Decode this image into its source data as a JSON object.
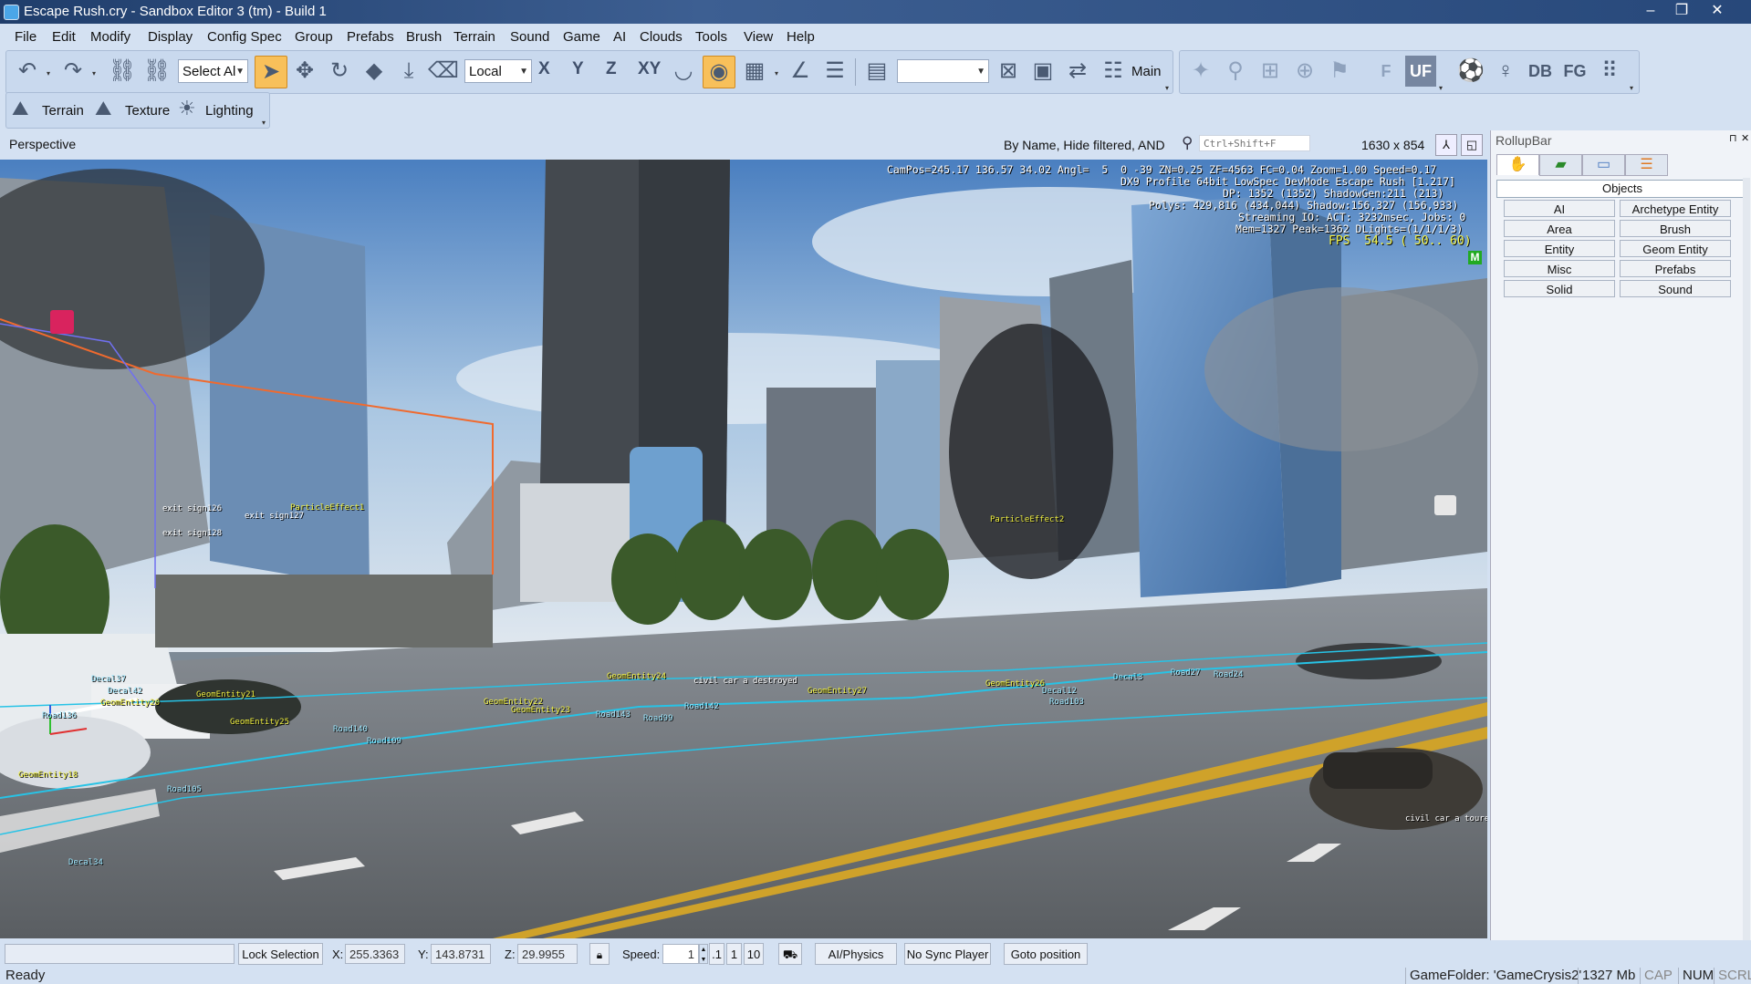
{
  "window": {
    "title": "Escape Rush.cry - Sandbox Editor 3 (tm) - Build 1",
    "min": "–",
    "max": "❐",
    "close": "✕"
  },
  "menu": [
    "File",
    "Edit",
    "Modify",
    "Display",
    "Config Spec",
    "Group",
    "Prefabs",
    "Brush",
    "Terrain",
    "Sound",
    "Game",
    "AI",
    "Clouds",
    "Tools",
    "View",
    "Help"
  ],
  "toolbar": {
    "select_mode": "Select Al",
    "coord_system": "Local",
    "axis_x": "X",
    "axis_y": "Y",
    "axis_z": "Z",
    "axis_xy": "XY",
    "layer_combo": "",
    "layer_label": "Main",
    "btn_f": "F",
    "btn_uf": "UF",
    "btn_db": "DB",
    "btn_fg": "FG"
  },
  "toolbar2": {
    "terrain": "Terrain",
    "texture": "Texture",
    "lighting": "Lighting"
  },
  "viewport": {
    "title": "Perspective",
    "filter": "By Name, Hide filtered, AND",
    "search_placeholder": "Ctrl+Shift+F",
    "resolution": "1630 x 854",
    "hud": [
      "CamPos=245.17 136.57 34.02 Angl=  5  0 -39 ZN=0.25 ZF=4563 FC=0.04 Zoom=1.00 Speed=0.17",
      "DX9 Profile 64bit LowSpec DevMode Escape Rush [1.217]",
      "DP: 1352 (1352) ShadowGen:211 (213)",
      "Polys: 429,816 (434,044) Shadow:156,327 (156,933)",
      "Streaming IO: ACT: 3232msec, Jobs: 0",
      "Mem=1327 Peak=1362 DLights=(1/1/1/3)"
    ],
    "fps": "FPS  54.5 ( 50.. 60)",
    "m_badge": "M",
    "labels": [
      {
        "text": "GeomEntity20",
        "c": "y"
      },
      {
        "text": "GeomEntity21",
        "c": "y"
      },
      {
        "text": "GeomEntity25",
        "c": "y"
      },
      {
        "text": "GeomEntity18",
        "c": "y"
      },
      {
        "text": "GeomEntity22",
        "c": "y"
      },
      {
        "text": "GeomEntity23",
        "c": "y"
      },
      {
        "text": "GeomEntity24",
        "c": "y"
      },
      {
        "text": "GeomEntity27",
        "c": "y"
      },
      {
        "text": "GeomEntity26",
        "c": "y"
      },
      {
        "text": "ParticleEffect1",
        "c": "y"
      },
      {
        "text": "ParticleEffect2",
        "c": "y"
      },
      {
        "text": "exit sign126",
        "c": "w"
      },
      {
        "text": "exit sign127",
        "c": "w"
      },
      {
        "text": "exit sign128",
        "c": "w"
      },
      {
        "text": "civil car a tourer",
        "c": "w"
      },
      {
        "text": "civil car a destroyed",
        "c": "w"
      },
      {
        "text": "Road136",
        "c": "c"
      },
      {
        "text": "Road140",
        "c": "c"
      },
      {
        "text": "Road109",
        "c": "c"
      },
      {
        "text": "Road105",
        "c": "c"
      },
      {
        "text": "Road143",
        "c": "c"
      },
      {
        "text": "Road99",
        "c": "c"
      },
      {
        "text": "Road142",
        "c": "c"
      },
      {
        "text": "Road103",
        "c": "c"
      },
      {
        "text": "Road24",
        "c": "c"
      },
      {
        "text": "Road27",
        "c": "c"
      },
      {
        "text": "Decal37",
        "c": "c"
      },
      {
        "text": "Decal42",
        "c": "c"
      },
      {
        "text": "Decal12",
        "c": "c"
      },
      {
        "text": "Decal3",
        "c": "c"
      },
      {
        "text": "Decal34",
        "c": "c"
      }
    ]
  },
  "rollup": {
    "title": "RollupBar",
    "pin": "⊓",
    "close": "✕",
    "section": "Objects",
    "buttons": [
      "AI",
      "Archetype Entity",
      "Area",
      "Brush",
      "Entity",
      "Geom Entity",
      "Misc",
      "Prefabs",
      "Solid",
      "Sound"
    ]
  },
  "bottom": {
    "lock_selection": "Lock Selection",
    "x_label": "X:",
    "x_value": "255.3363",
    "y_label": "Y:",
    "y_value": "143.8731",
    "z_label": "Z:",
    "z_value": "29.9955",
    "speed_label": "Speed:",
    "speed_value": "1",
    "speed_01": ".1",
    "speed_1": "1",
    "speed_10": "10",
    "ai_physics": "AI/Physics",
    "no_sync": "No Sync Player",
    "goto": "Goto position"
  },
  "status": {
    "ready": "Ready",
    "gamefolder": "GameFolder: 'GameCrysis2'",
    "mem": "1327 Mb",
    "cap": "CAP",
    "num": "NUM",
    "scrl": "SCRL"
  }
}
